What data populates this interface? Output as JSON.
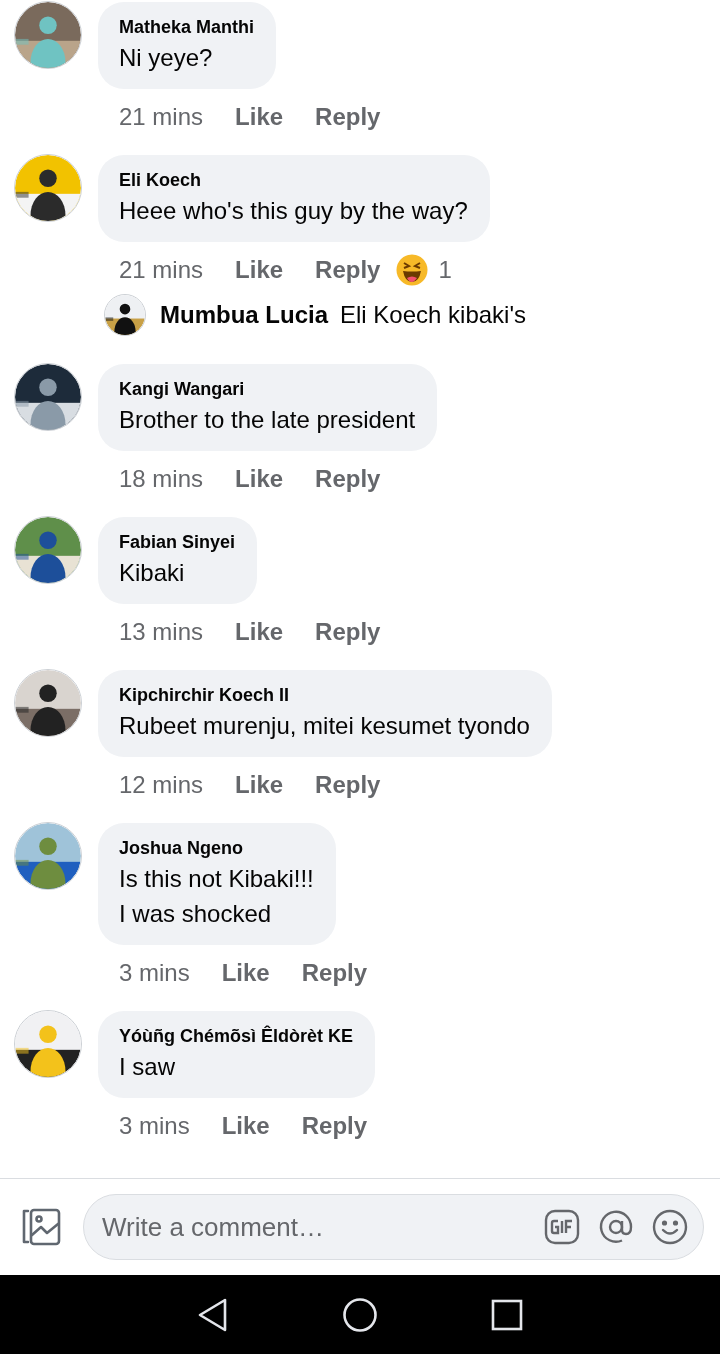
{
  "comments": [
    {
      "author": "Matheka Manthi",
      "text": "Ni yeye?",
      "time": "21 mins",
      "like": "Like",
      "reply": "Reply"
    },
    {
      "author": "Eli Koech",
      "text": "Heee who's this guy by the way?",
      "time": "21 mins",
      "like": "Like",
      "reply": "Reply",
      "reaction": {
        "count": "1"
      },
      "replies": [
        {
          "author": "Mumbua Lucia",
          "text": "Eli Koech kibaki's"
        }
      ]
    },
    {
      "author": "Kangi Wangari",
      "text": "Brother to the late president",
      "time": "18 mins",
      "like": "Like",
      "reply": "Reply"
    },
    {
      "author": "Fabian Sinyei",
      "text": "Kibaki",
      "time": "13 mins",
      "like": "Like",
      "reply": "Reply"
    },
    {
      "author": "Kipchirchir Koech II",
      "text": "Rubeet murenju, mitei kesumet tyondo",
      "time": "12 mins",
      "like": "Like",
      "reply": "Reply"
    },
    {
      "author": "Joshua Ngeno",
      "text": "Is this not Kibaki!!!\nI was shocked",
      "time": "3 mins",
      "like": "Like",
      "reply": "Reply"
    },
    {
      "author": "Yóùñg Chémõsì Êldòrèt KE",
      "text": "I saw",
      "time": "3 mins",
      "like": "Like",
      "reply": "Reply"
    }
  ],
  "composer": {
    "placeholder": "Write a comment…"
  }
}
